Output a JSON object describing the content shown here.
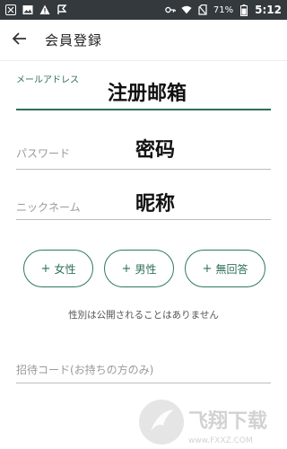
{
  "status_bar": {
    "battery": "71%",
    "time": "5:12"
  },
  "app_bar": {
    "title": "会員登録"
  },
  "form": {
    "email": {
      "label": "メールアドレス",
      "value": "注册邮箱"
    },
    "password": {
      "label": "パスワード",
      "value": "密码"
    },
    "nickname": {
      "label": "ニックネーム",
      "value": "昵称"
    },
    "gender_buttons": [
      {
        "plus": "+",
        "label": "女性"
      },
      {
        "plus": "+",
        "label": "男性"
      },
      {
        "plus": "+",
        "label": "無回答"
      }
    ],
    "gender_note": "性別は公開されることはありません",
    "invite_code": {
      "placeholder": "招待コード(お持ちの方のみ)"
    }
  },
  "watermark": {
    "brand": "飞翔下载",
    "domain": "www.FXXZ.COM"
  },
  "colors": {
    "status_bar": "#34393d",
    "accent": "#2f6f57"
  },
  "icons": [
    "back-arrow-icon",
    "wifi-icon",
    "battery-icon",
    "key-icon",
    "warning-icon"
  ]
}
